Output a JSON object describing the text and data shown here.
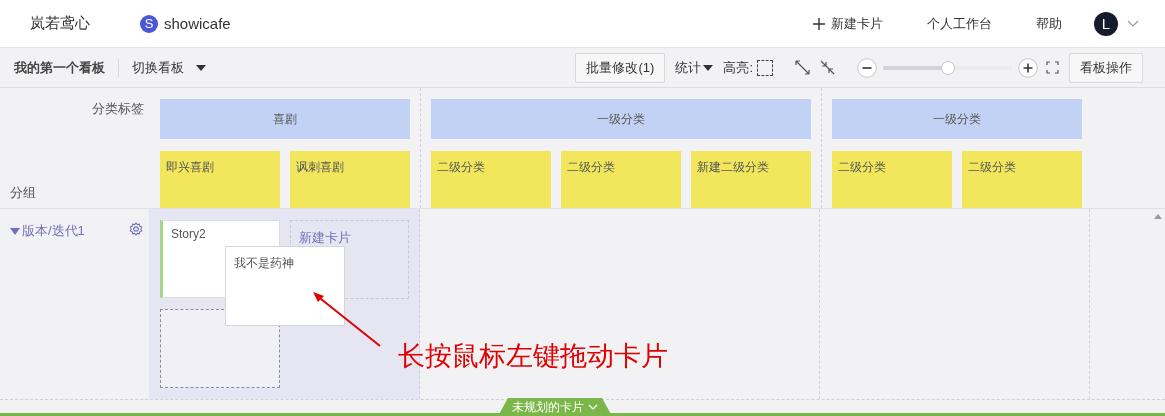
{
  "header": {
    "workspace": "岚若鸢心",
    "project_initial": "S",
    "project": "showicafe",
    "actions": [
      {
        "kind": "new",
        "label": "新建卡片"
      },
      {
        "kind": "link",
        "label": "个人工作台"
      },
      {
        "kind": "link",
        "label": "帮助"
      }
    ],
    "user_initial": "L"
  },
  "toolbar": {
    "board_title": "我的第一个看板",
    "switch_label": "切换看板",
    "batch_button": "批量修改(1)",
    "stats_label": "统计",
    "highlight_label": "高亮:",
    "zoom": {
      "level": 0.5
    },
    "board_ops_button": "看板操作"
  },
  "corner": {
    "category_label": "分类标签",
    "group_label": "分组"
  },
  "categories": [
    {
      "label": "喜剧",
      "children": [
        {
          "label": "即兴喜剧"
        },
        {
          "label": "讽刺喜剧"
        }
      ]
    },
    {
      "label": "一级分类",
      "children": [
        {
          "label": "二级分类"
        },
        {
          "label": "二级分类"
        },
        {
          "label": "新建二级分类"
        }
      ]
    },
    {
      "label": "一级分类",
      "children": [
        {
          "label": "二级分类"
        },
        {
          "label": "二级分类"
        }
      ]
    }
  ],
  "lanes": [
    {
      "label": "版本/迭代1",
      "expanded": true,
      "cards": [
        {
          "title": "Story2"
        }
      ],
      "new_card": "新建卡片"
    }
  ],
  "drag_card": {
    "title": "我不是药神"
  },
  "annotation": "长按鼠标左键拖动卡片",
  "backlog_tab": "未规划的卡片"
}
